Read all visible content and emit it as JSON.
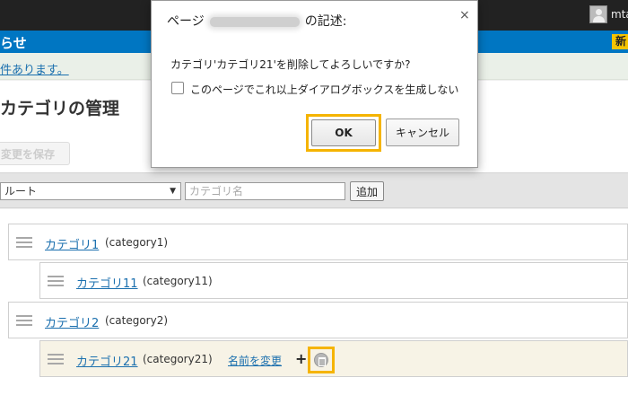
{
  "header": {
    "user_name": "mta",
    "section_title": "らせ",
    "new_badge": "新"
  },
  "notice": {
    "link_text": "件あります。"
  },
  "page": {
    "title": "カテゴリの管理",
    "save_label": "変更を保存"
  },
  "filter": {
    "root_select_value": "ルート",
    "name_placeholder": "カテゴリ名",
    "add_label": "追加"
  },
  "tree": {
    "rows": [
      {
        "name": "カテゴリ1",
        "code": "(category1)"
      },
      {
        "name": "カテゴリ11",
        "code": "(category11)"
      },
      {
        "name": "カテゴリ2",
        "code": "(category2)"
      },
      {
        "name": "カテゴリ21",
        "code": "(category21)",
        "rename_label": "名前を変更",
        "plus": "+"
      }
    ]
  },
  "dialog": {
    "title_prefix": "ページ",
    "title_suffix": "の記述:",
    "close": "×",
    "message": "カテゴリ'カテゴリ21'を削除してよろしいですか?",
    "checkbox_label": "このページでこれ以上ダイアログボックスを生成しない",
    "ok_label": "OK",
    "cancel_label": "キャンセル"
  },
  "colors": {
    "header_blue": "#0076c2",
    "highlight": "#f5b400",
    "link": "#1a6fae"
  },
  "icons": {
    "avatar": "user-avatar-icon",
    "drag": "drag-handle-icon",
    "delete": "trash-icon",
    "dropdown": "chevron-down-icon"
  }
}
